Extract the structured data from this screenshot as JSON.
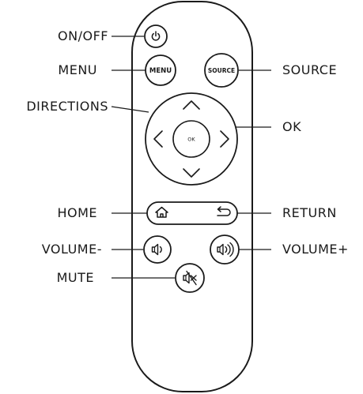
{
  "callouts": {
    "on_off": "ON/OFF",
    "menu": "MENU",
    "directions": "DIRECTIONS",
    "home": "HOME",
    "volume_minus": "VOLUME-",
    "mute": "MUTE",
    "source": "SOURCE",
    "ok": "OK",
    "return": "RETURN",
    "volume_plus": "VOLUME+"
  },
  "buttons": {
    "menu": "MENU",
    "source": "SOURCE",
    "ok": "OK"
  },
  "icons": {
    "power": "power-icon",
    "home": "home-icon",
    "return": "return-icon",
    "volume_down": "volume-down-icon",
    "volume_up": "volume-up-icon",
    "mute": "mute-icon",
    "arrow_up": "chevron-up-icon",
    "arrow_down": "chevron-down-icon",
    "arrow_left": "chevron-left-icon",
    "arrow_right": "chevron-right-icon"
  },
  "colors": {
    "stroke": "#1a1a1a",
    "background": "#ffffff"
  }
}
